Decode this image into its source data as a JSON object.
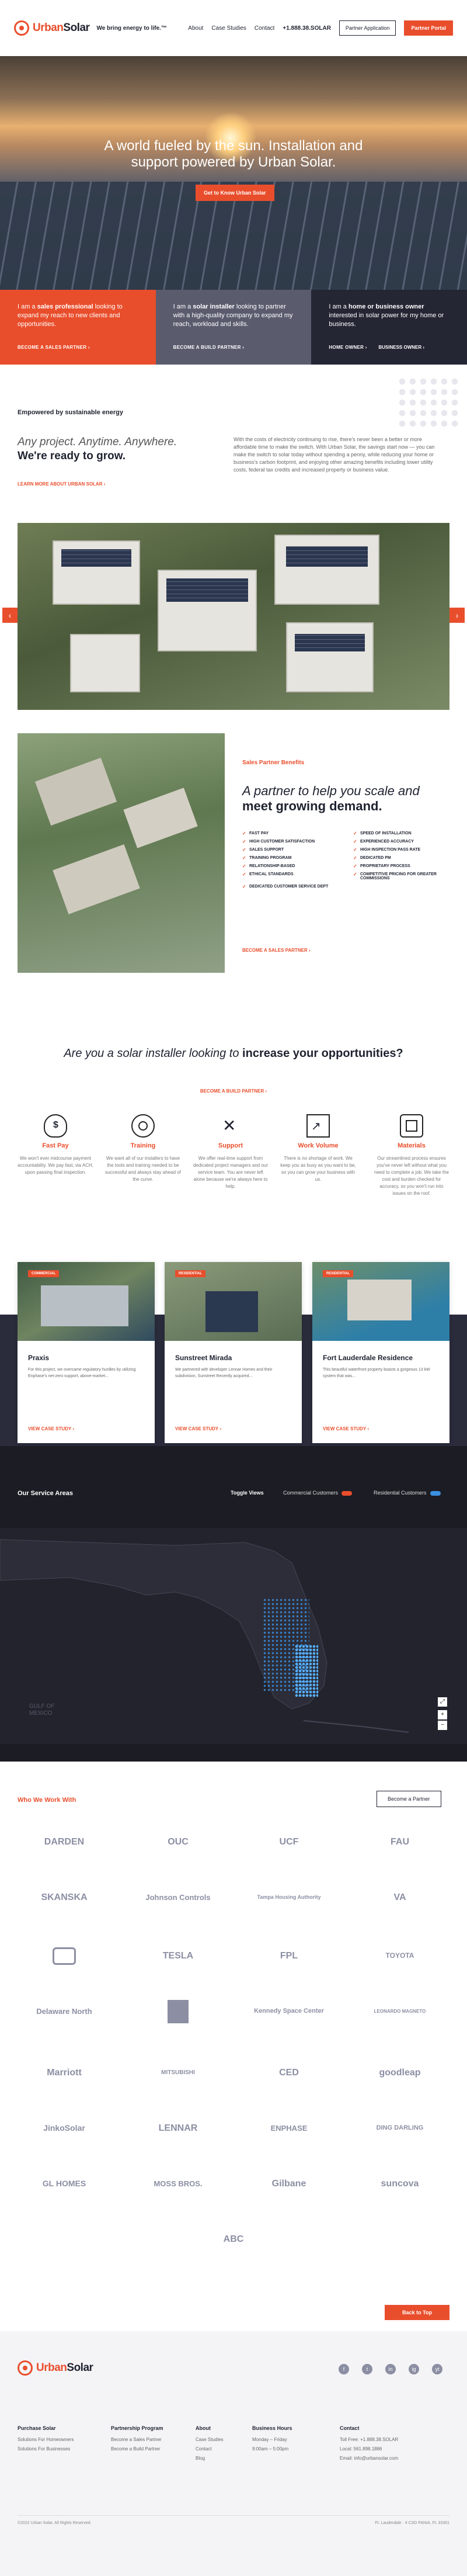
{
  "header": {
    "logo_a": "Urban",
    "logo_b": "Solar",
    "tagline": "We bring energy to life.™",
    "nav": [
      "About",
      "Case Studies",
      "Contact"
    ],
    "phone": "+1.888.38.SOLAR",
    "partner_app": "Partner Application",
    "partner_portal": "Partner Portal"
  },
  "hero": {
    "title": "A world fueled by the sun. Installation and support powered by Urban Solar.",
    "cta": "Get to Know Urban Solar"
  },
  "cards": [
    {
      "pre": "I am a ",
      "bold": "sales professional",
      "post": " looking to expand my reach to new clients and opportunities.",
      "link": "BECOME A SALES PARTNER",
      "color": "#e94e2c"
    },
    {
      "pre": "I am a ",
      "bold": "solar installer",
      "post": " looking to partner with a high-quality company to expand my reach, workload and skills.",
      "link": "BECOME A BUILD PARTNER",
      "color": "#5a5c6e"
    },
    {
      "pre": "I am a ",
      "bold": "home or business owner",
      "post": " interested in solar power for my home or business.",
      "link": "HOME OWNER",
      "link2": "BUSINESS OWNER",
      "color": "#242634"
    }
  ],
  "empowered": {
    "eyebrow": "Empowered by sustainable energy",
    "h_italic": "Any project. Anytime. Anywhere.",
    "h_bold": "We're ready to grow.",
    "link": "LEARN MORE ABOUT URBAN SOLAR",
    "body": "With the costs of electricity continuing to rise, there's never been a better or more affordable time to make the switch. With Urban Solar, the savings start now — you can make the switch to solar today without spending a penny, while reducing your home or business's carbon footprint, and enjoying other amazing benefits including lower utility costs, federal tax credits and increased property or business value."
  },
  "gallery": {
    "prev": "‹",
    "next": "›"
  },
  "partner": {
    "eyebrow": "Sales Partner Benefits",
    "h_italic": "A partner to help you scale and ",
    "h_bold": "meet growing demand.",
    "benefits": [
      "FAST PAY",
      "SPEED OF INSTALLATION",
      "HIGH CUSTOMER SATISFACTION",
      "EXPERIENCED ACCURACY",
      "SALES SUPPORT",
      "HIGH INSPECTION PASS RATE",
      "TRAINING PROGRAM",
      "DEDICATED PM",
      "RELATIONSHIP-BASED",
      "PROPRIETARY PROCESS",
      "ETHICAL STANDARDS",
      "COMPETITIVE PRICING FOR GREATER COMMISSIONS",
      "DEDICATED CUSTOMER SERVICE DEPT"
    ],
    "link": "BECOME A SALES PARTNER"
  },
  "installer": {
    "h_italic": "Are you a solar installer looking to ",
    "h_bold": "increase your opportunities?",
    "link": "BECOME A BUILD PARTNER",
    "features": [
      {
        "icon": "money-bag-icon",
        "title": "Fast Pay",
        "text": "We won't ever midcourse payment accountability. We pay fast, via ACH, upon passing final inspection."
      },
      {
        "icon": "target-icon",
        "title": "Training",
        "text": "We want all of our installers to have the tools and training needed to be successful and always stay ahead of the curve."
      },
      {
        "icon": "tools-icon",
        "title": "Support",
        "text": "We offer real-time support from dedicated project managers and our service team. You are never left alone because we're always here to help."
      },
      {
        "icon": "growth-chart-icon",
        "title": "Work Volume",
        "text": "There is no shortage of work. We keep you as busy as you want to be, so you can grow your business with us."
      },
      {
        "icon": "layers-icon",
        "title": "Materials",
        "text": "Our streamlined process ensures you've never left without what you need to complete a job. We take the cost and burden checked for accuracy, so you won't run into issues on the roof."
      }
    ]
  },
  "cases": [
    {
      "tag": "COMMERCIAL",
      "title": "Praxis",
      "text": "For this project, we overcame regulatory hurdles by utilizing Enphase's net-zero support, above-market...",
      "link": "VIEW CASE STUDY"
    },
    {
      "tag": "RESIDENTIAL",
      "title": "Sunstreet Mirada",
      "text": "We partnered with developer Lennar Homes and their subdivision, Sunstreet Recently acquired...",
      "link": "VIEW CASE STUDY"
    },
    {
      "tag": "RESIDENTIAL",
      "title": "Fort Lauderdale Residence",
      "text": "This beautiful waterfront property boasts a gorgeous 13 kW system that was...",
      "link": "VIEW CASE STUDY"
    }
  ],
  "service": {
    "title": "Our Service Areas",
    "toggle": "Toggle Views",
    "commercial": "Commercial Customers",
    "residential": "Residential Customers",
    "map_label": "GULF OF MEXICO",
    "colors": {
      "commercial": "#e94e2c",
      "residential": "#3b8fe0"
    }
  },
  "who": {
    "eyebrow": "Who We Work With",
    "cta": "Become a Partner",
    "logos": [
      "DARDEN",
      "OUC",
      "UCF",
      "FAU",
      "SKANSKA",
      "Johnson Controls",
      "Tampa Housing Authority",
      "VA",
      "",
      "TESLA",
      "FPL",
      "TOYOTA",
      "Delaware North",
      "",
      "Kennedy Space Center",
      "LEONARDO MAGNETO",
      "Marriott",
      "MITSUBISHI",
      "CED",
      "goodleap",
      "JinkoSolar",
      "LENNAR",
      "ENPHASE",
      "DING DARLING",
      "GL HOMES",
      "MOSS BROS.",
      "Gilbane",
      "suncova",
      "ABC"
    ],
    "back_to_top": "Back to Top"
  },
  "footer": {
    "social": [
      "f",
      "t",
      "in",
      "ig",
      "yt"
    ],
    "cols": [
      {
        "title": "Purchase Solar",
        "items": [
          "Solutions For Homeowners",
          "Solutions For Businesses"
        ]
      },
      {
        "title": "Partnership Program",
        "items": [
          "Become a Sales Partner",
          "Become a Build Partner"
        ]
      },
      {
        "title": "About",
        "items": [
          "Case Studies",
          "Contact",
          "Blog"
        ]
      },
      {
        "title": "Business Hours",
        "items": [
          "Monday – Friday",
          "9:00am – 5:00pm"
        ]
      },
      {
        "title": "Contact",
        "items": [
          "Toll Free: +1.888.38.SOLAR",
          "Local: 561.898.1886",
          "Email: info@urbansolar.com"
        ]
      }
    ],
    "copyright": "©2022 Urban Solar. All Rights Reserved.",
    "address": "Ft. Lauderdale · 4 CSD PANIA, FL 33301"
  }
}
